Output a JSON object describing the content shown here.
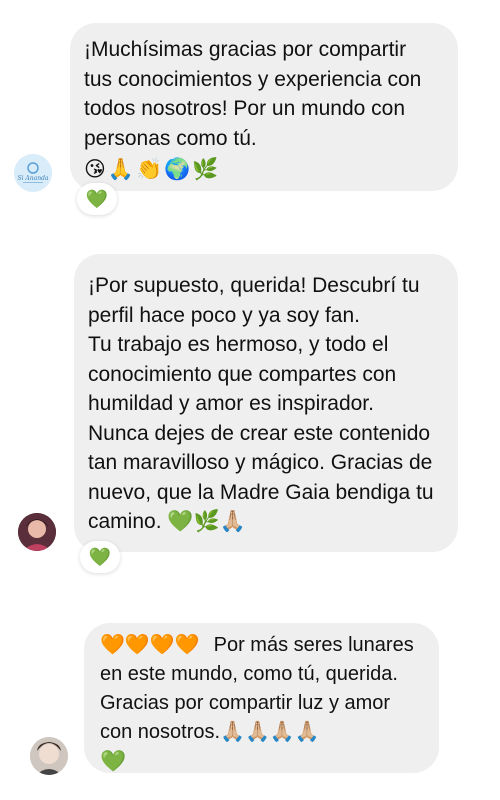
{
  "messages": [
    {
      "text": "¡Muchísimas gracias por compartir tus conocimientos y experiencia con todos nosotros! Por un mundo con personas como tú.",
      "emojis": "😘🙏👏🌍🌿",
      "reaction": "💚",
      "avatar": "logo-avatar"
    },
    {
      "text": "¡Por supuesto, querida! Descubrí tu perfil hace poco y ya soy fan.\nTu trabajo es hermoso, y todo el conocimiento que compartes con humildad y amor es inspirador. Nunca dejes de crear este contenido tan maravilloso y mágico. Gracias de nuevo, que la Madre Gaia bendiga tu camino. 💚🌿🙏🏼",
      "reaction": "💚",
      "avatar": "photo-avatar"
    },
    {
      "lead_emojis": "🧡🧡🧡🧡",
      "text": "Por más seres lunares en este mundo, como tú, querida. Gracias por compartir luz y amor con nosotros.🙏🏼🙏🏼🙏🏼🙏🏼",
      "trail_emoji": "💚",
      "avatar": "photo-avatar-2"
    }
  ],
  "colors": {
    "bubble": "#efefef",
    "logo_bg": "#cfe6f7",
    "logo_ring": "#5aa0d6"
  }
}
